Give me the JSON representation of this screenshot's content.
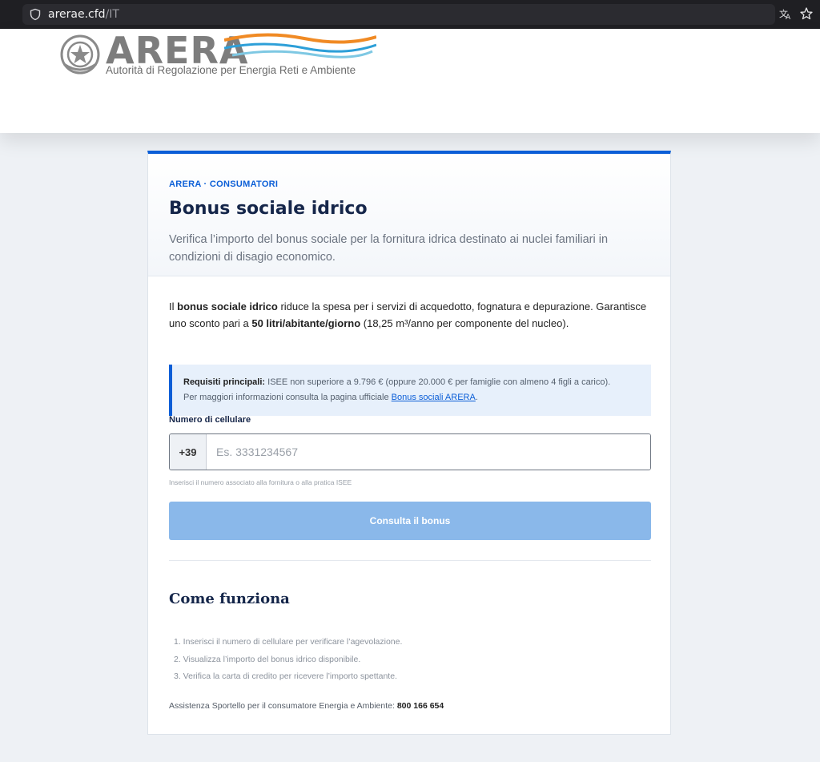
{
  "browser": {
    "url_domain": "arerae.cfd",
    "url_path": "/IT"
  },
  "header": {
    "logo_text": "ARERA",
    "logo_subtitle": "Autorità di Regolazione per Energia Reti e Ambiente",
    "wave_colors": [
      "#f08a24",
      "#2d9fd8",
      "#7ec8e3"
    ]
  },
  "card": {
    "eyebrow": "ARERA · CONSUMATORI",
    "title": "Bonus sociale idrico",
    "subtitle": "Verifica l’importo del bonus sociale per la fornitura idrica destinato ai nuclei familiari in condizioni di disagio economico.",
    "intro": {
      "p1": "Il ",
      "b1": "bonus sociale idrico",
      "p2": " riduce la spesa per i servizi di acquedotto, fognatura e depurazione. Garantisce uno sconto pari a ",
      "b2": "50 litri/abitante/giorno",
      "p3": " (18,25 m³/anno per componente del nucleo)."
    },
    "info": {
      "label": "Requisiti principali:",
      "text": " ISEE non superiore a 9.796 € (oppure 20.000 € per famiglie con almeno 4 figli a carico).",
      "line2": "Per maggiori informazioni consulta la pagina ufficiale ",
      "link": "Bonus sociali ARERA",
      "end": "."
    },
    "form": {
      "label": "Numero di cellulare",
      "prefix": "+39",
      "placeholder": "Es. 3331234567",
      "hint": "Inserisci il numero associato alla fornitura o alla pratica ISEE",
      "button": "Consulta il bonus"
    },
    "how": {
      "title": "Come funziona",
      "steps": [
        "1. Inserisci il numero di cellulare per verificare l’agevolazione.",
        "2. Visualizza l’importo del bonus idrico disponibile.",
        "3. Verifica la carta di credito per ricevere l’importo spettante."
      ],
      "assist_text": "Assistenza Sportello per il consumatore Energia e Ambiente: ",
      "assist_phone": "800 166 654"
    }
  },
  "colors": {
    "accent": "#0b5ed7",
    "button": "#8ab8ea",
    "title": "#15264a"
  }
}
